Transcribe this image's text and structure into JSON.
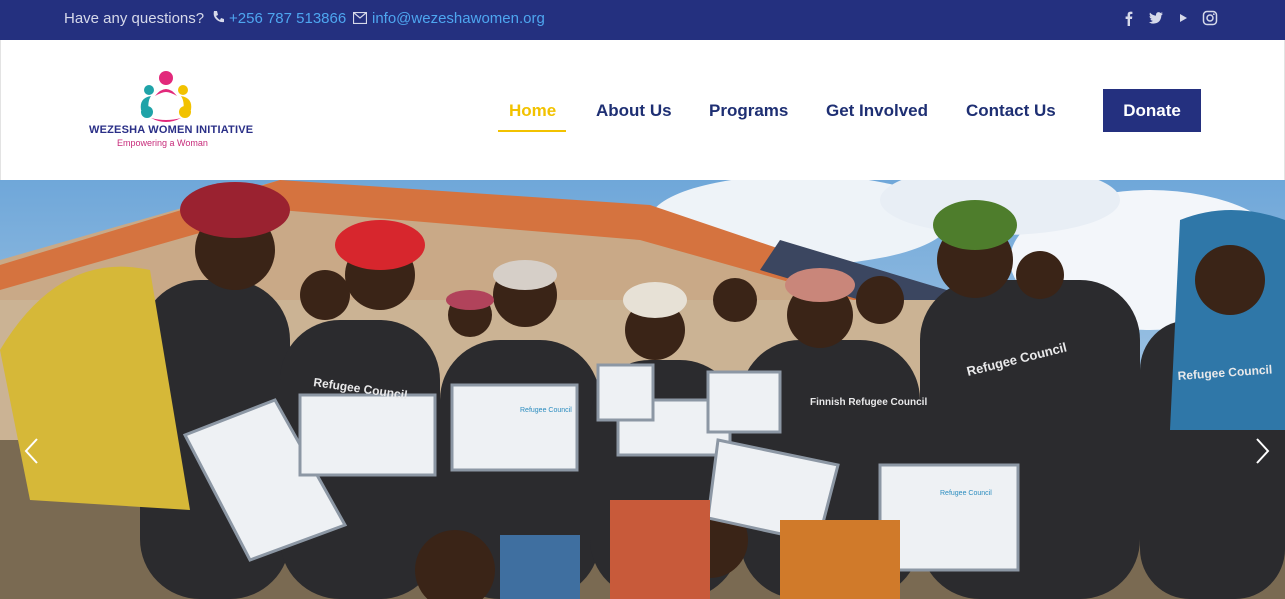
{
  "topbar": {
    "question": "Have any questions?",
    "phone": "+256 787 513866",
    "email": "info@wezeshawomen.org",
    "social_icons": [
      "facebook-icon",
      "twitter-icon",
      "youtube-icon",
      "instagram-icon"
    ]
  },
  "logo": {
    "title": "WEZESHA WOMEN INITIATIVE",
    "tagline": "Empowering a Woman"
  },
  "nav": {
    "items": [
      {
        "label": "Home",
        "active": true
      },
      {
        "label": "About Us"
      },
      {
        "label": "Programs"
      },
      {
        "label": "Get Involved"
      },
      {
        "label": "Contact Us"
      }
    ],
    "donate": "Donate"
  },
  "hero": {
    "shirt_text_1": "Refugee Council",
    "shirt_text_2": "Finnish Refugee Council",
    "certificate_header": "Refugee Council"
  },
  "colors": {
    "topbar": "#24307f",
    "nav_text": "#1e2f73",
    "active": "#f2c200",
    "link": "#4ea6f0"
  }
}
